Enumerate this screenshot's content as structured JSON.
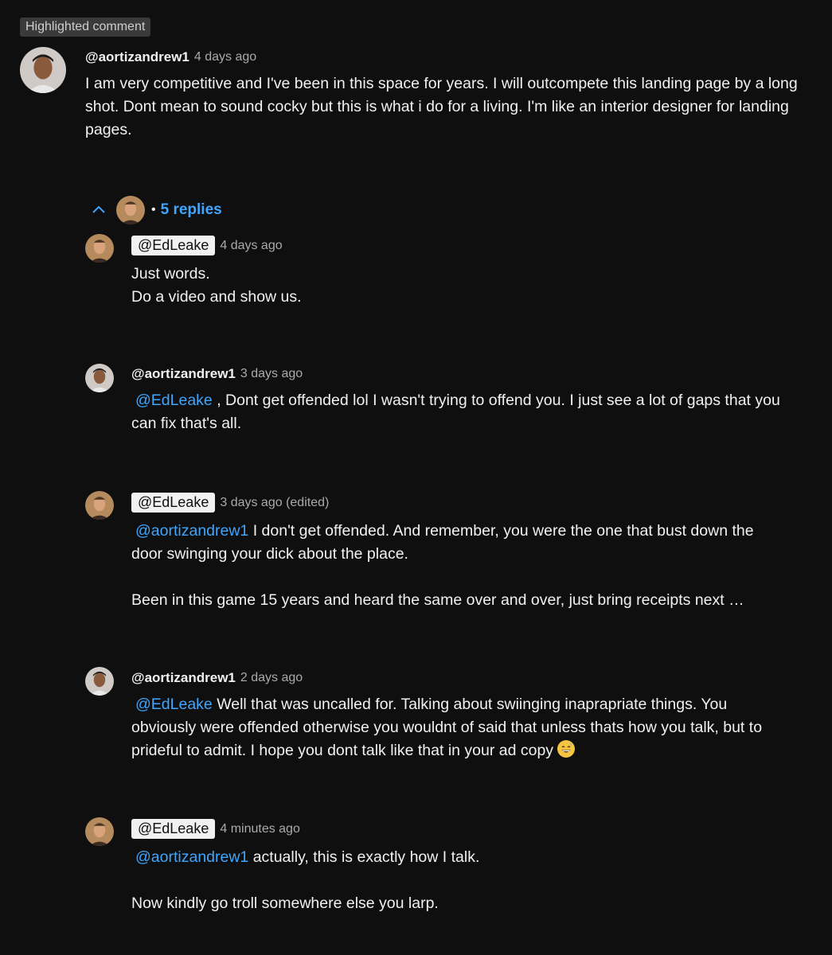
{
  "badge": "Highlighted comment",
  "comment": {
    "author": "@aortizandrew1",
    "time": "4 days ago",
    "text": "I am very competitive and I've been in this space for years. I will outcompete this landing page by a long shot. Dont mean to sound cocky but this is what i do for a living. I'm like an interior designer for landing pages."
  },
  "replies_toggle": {
    "label": "5 replies"
  },
  "replies": [
    {
      "author": "@EdLeake",
      "time": "4 days ago",
      "lines": [
        "Just words.",
        "Do a video and show us."
      ]
    },
    {
      "author": "@aortizandrew1",
      "time": "3 days ago",
      "mention": "@EdLeake",
      "text": " , Dont get offended lol I wasn't trying to offend you. I just see a lot of gaps that you can fix that's all."
    },
    {
      "author": "@EdLeake",
      "time": "3 days ago (edited)",
      "mention": "@aortizandrew1",
      "text": "  I don't get offended. And remember, you were the one that bust down the door swinging your dick about the place.",
      "text2": "Been in this game 15 years and heard the same over and over, just bring receipts next …"
    },
    {
      "author": "@aortizandrew1",
      "time": "2 days ago",
      "mention": "@EdLeake",
      "text": "  Well that was uncalled for. Talking about swiinging inaprapriate things. You obviously were offended otherwise you wouldnt of said that unless thats how you talk, but to prideful to admit. I hope you dont talk like that in your ad copy",
      "emoji": "grinning-sweat-emoji"
    },
    {
      "author": "@EdLeake",
      "time": "4 minutes ago",
      "mention": "@aortizandrew1",
      "text": " actually, this is exactly how I talk.",
      "text2": "Now kindly go troll somewhere else you larp."
    }
  ],
  "colors": {
    "background": "#0f0f0f",
    "link": "#3ea6ff",
    "muted": "#aaaaaa",
    "badge_bg": "#3a3a3a"
  }
}
